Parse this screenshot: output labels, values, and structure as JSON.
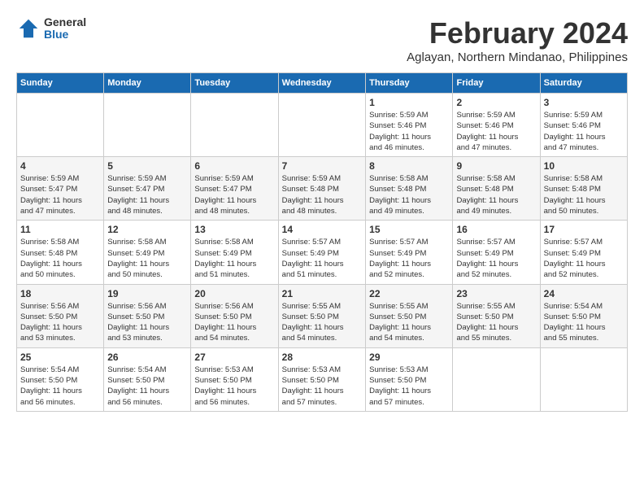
{
  "logo": {
    "general": "General",
    "blue": "Blue"
  },
  "title": {
    "month_year": "February 2024",
    "location": "Aglayan, Northern Mindanao, Philippines"
  },
  "weekdays": [
    "Sunday",
    "Monday",
    "Tuesday",
    "Wednesday",
    "Thursday",
    "Friday",
    "Saturday"
  ],
  "weeks": [
    [
      {
        "day": "",
        "info": ""
      },
      {
        "day": "",
        "info": ""
      },
      {
        "day": "",
        "info": ""
      },
      {
        "day": "",
        "info": ""
      },
      {
        "day": "1",
        "info": "Sunrise: 5:59 AM\nSunset: 5:46 PM\nDaylight: 11 hours\nand 46 minutes."
      },
      {
        "day": "2",
        "info": "Sunrise: 5:59 AM\nSunset: 5:46 PM\nDaylight: 11 hours\nand 47 minutes."
      },
      {
        "day": "3",
        "info": "Sunrise: 5:59 AM\nSunset: 5:46 PM\nDaylight: 11 hours\nand 47 minutes."
      }
    ],
    [
      {
        "day": "4",
        "info": "Sunrise: 5:59 AM\nSunset: 5:47 PM\nDaylight: 11 hours\nand 47 minutes."
      },
      {
        "day": "5",
        "info": "Sunrise: 5:59 AM\nSunset: 5:47 PM\nDaylight: 11 hours\nand 48 minutes."
      },
      {
        "day": "6",
        "info": "Sunrise: 5:59 AM\nSunset: 5:47 PM\nDaylight: 11 hours\nand 48 minutes."
      },
      {
        "day": "7",
        "info": "Sunrise: 5:59 AM\nSunset: 5:48 PM\nDaylight: 11 hours\nand 48 minutes."
      },
      {
        "day": "8",
        "info": "Sunrise: 5:58 AM\nSunset: 5:48 PM\nDaylight: 11 hours\nand 49 minutes."
      },
      {
        "day": "9",
        "info": "Sunrise: 5:58 AM\nSunset: 5:48 PM\nDaylight: 11 hours\nand 49 minutes."
      },
      {
        "day": "10",
        "info": "Sunrise: 5:58 AM\nSunset: 5:48 PM\nDaylight: 11 hours\nand 50 minutes."
      }
    ],
    [
      {
        "day": "11",
        "info": "Sunrise: 5:58 AM\nSunset: 5:48 PM\nDaylight: 11 hours\nand 50 minutes."
      },
      {
        "day": "12",
        "info": "Sunrise: 5:58 AM\nSunset: 5:49 PM\nDaylight: 11 hours\nand 50 minutes."
      },
      {
        "day": "13",
        "info": "Sunrise: 5:58 AM\nSunset: 5:49 PM\nDaylight: 11 hours\nand 51 minutes."
      },
      {
        "day": "14",
        "info": "Sunrise: 5:57 AM\nSunset: 5:49 PM\nDaylight: 11 hours\nand 51 minutes."
      },
      {
        "day": "15",
        "info": "Sunrise: 5:57 AM\nSunset: 5:49 PM\nDaylight: 11 hours\nand 52 minutes."
      },
      {
        "day": "16",
        "info": "Sunrise: 5:57 AM\nSunset: 5:49 PM\nDaylight: 11 hours\nand 52 minutes."
      },
      {
        "day": "17",
        "info": "Sunrise: 5:57 AM\nSunset: 5:49 PM\nDaylight: 11 hours\nand 52 minutes."
      }
    ],
    [
      {
        "day": "18",
        "info": "Sunrise: 5:56 AM\nSunset: 5:50 PM\nDaylight: 11 hours\nand 53 minutes."
      },
      {
        "day": "19",
        "info": "Sunrise: 5:56 AM\nSunset: 5:50 PM\nDaylight: 11 hours\nand 53 minutes."
      },
      {
        "day": "20",
        "info": "Sunrise: 5:56 AM\nSunset: 5:50 PM\nDaylight: 11 hours\nand 54 minutes."
      },
      {
        "day": "21",
        "info": "Sunrise: 5:55 AM\nSunset: 5:50 PM\nDaylight: 11 hours\nand 54 minutes."
      },
      {
        "day": "22",
        "info": "Sunrise: 5:55 AM\nSunset: 5:50 PM\nDaylight: 11 hours\nand 54 minutes."
      },
      {
        "day": "23",
        "info": "Sunrise: 5:55 AM\nSunset: 5:50 PM\nDaylight: 11 hours\nand 55 minutes."
      },
      {
        "day": "24",
        "info": "Sunrise: 5:54 AM\nSunset: 5:50 PM\nDaylight: 11 hours\nand 55 minutes."
      }
    ],
    [
      {
        "day": "25",
        "info": "Sunrise: 5:54 AM\nSunset: 5:50 PM\nDaylight: 11 hours\nand 56 minutes."
      },
      {
        "day": "26",
        "info": "Sunrise: 5:54 AM\nSunset: 5:50 PM\nDaylight: 11 hours\nand 56 minutes."
      },
      {
        "day": "27",
        "info": "Sunrise: 5:53 AM\nSunset: 5:50 PM\nDaylight: 11 hours\nand 56 minutes."
      },
      {
        "day": "28",
        "info": "Sunrise: 5:53 AM\nSunset: 5:50 PM\nDaylight: 11 hours\nand 57 minutes."
      },
      {
        "day": "29",
        "info": "Sunrise: 5:53 AM\nSunset: 5:50 PM\nDaylight: 11 hours\nand 57 minutes."
      },
      {
        "day": "",
        "info": ""
      },
      {
        "day": "",
        "info": ""
      }
    ]
  ]
}
